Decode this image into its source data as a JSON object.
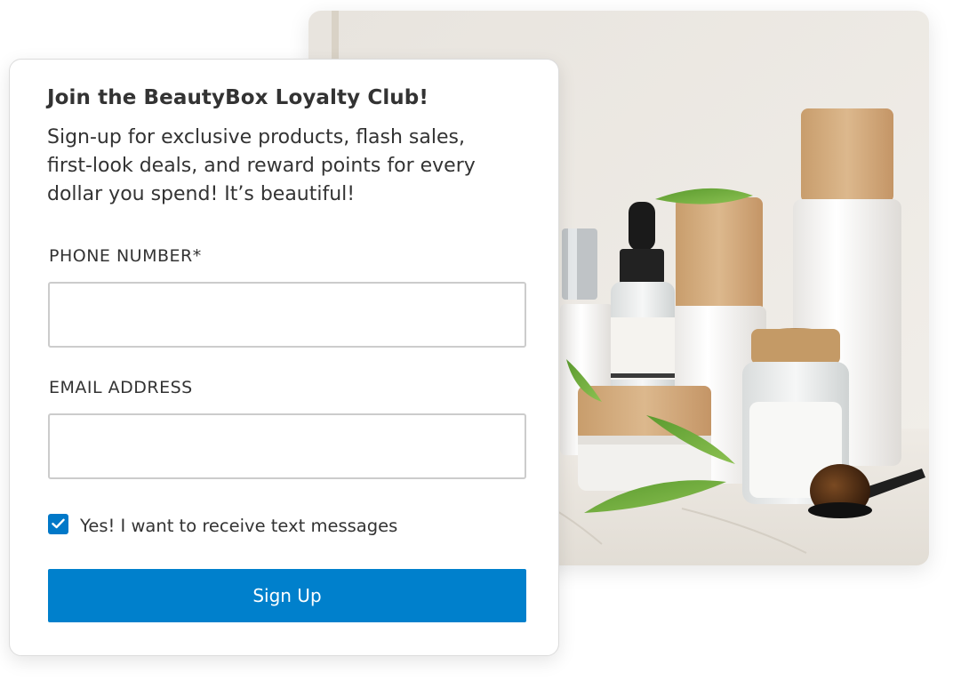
{
  "signup_card": {
    "title": "Join the BeautyBox Loyalty Club!",
    "description": "Sign-up for exclusive products, flash sales, first-look deals, and reward points for every dollar you spend! It’s beautiful!",
    "phone": {
      "label": "PHONE NUMBER*",
      "value": "",
      "placeholder": ""
    },
    "email": {
      "label": "EMAIL ADDRESS",
      "value": "",
      "placeholder": ""
    },
    "sms_consent": {
      "label": "Yes! I want to receive text messages",
      "checked": true
    },
    "submit_label": "Sign Up"
  },
  "product_photo": {
    "subject": "cosmetic-bottles-jars-and-brush"
  },
  "colors": {
    "accent": "#0080cc",
    "checkbox": "#0078c8",
    "text": "#333333",
    "input_border": "#cccccc"
  },
  "icons": {
    "checkbox": "checkmark-icon"
  }
}
